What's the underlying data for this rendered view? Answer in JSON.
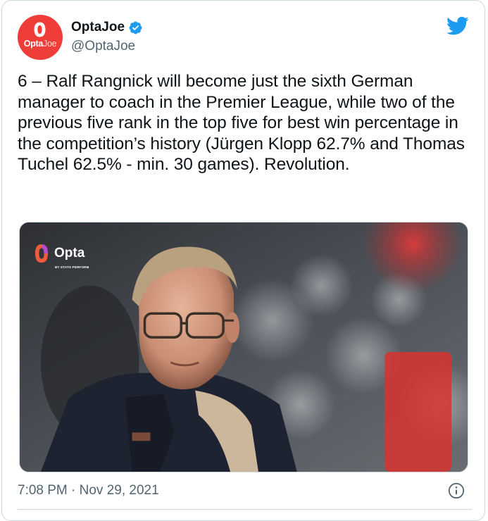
{
  "author": {
    "display_name": "OptaJoe",
    "handle": "@OptaJoe",
    "verified": true,
    "avatar_icon": "opta-logo-icon",
    "avatar_brand_bold": "Opta",
    "avatar_brand_light": "Joe"
  },
  "tweet": {
    "text": "6 – Ralf Rangnick will become just the sixth German manager to coach in the Premier League, while two of the previous five rank in the top five for best win percentage in the competition’s history (Jürgen Klopp 62.7% and Thomas Tuchel 62.5% - min. 30 games). Revolution.",
    "timestamp": "7:08 PM · Nov 29, 2021"
  },
  "media": {
    "logo_word": "Opta",
    "logo_subtitle": "BY STATS PERFORM",
    "logo_icon": "opta-mark-icon"
  },
  "icons": {
    "brand": "twitter-bird-icon",
    "verified": "verified-badge-icon",
    "info": "info-icon"
  },
  "colors": {
    "accent": "#1d9bf0",
    "opta_red": "#ef3d3a",
    "text_primary": "#0f1419",
    "text_secondary": "#536471",
    "border": "#cfd9de"
  }
}
